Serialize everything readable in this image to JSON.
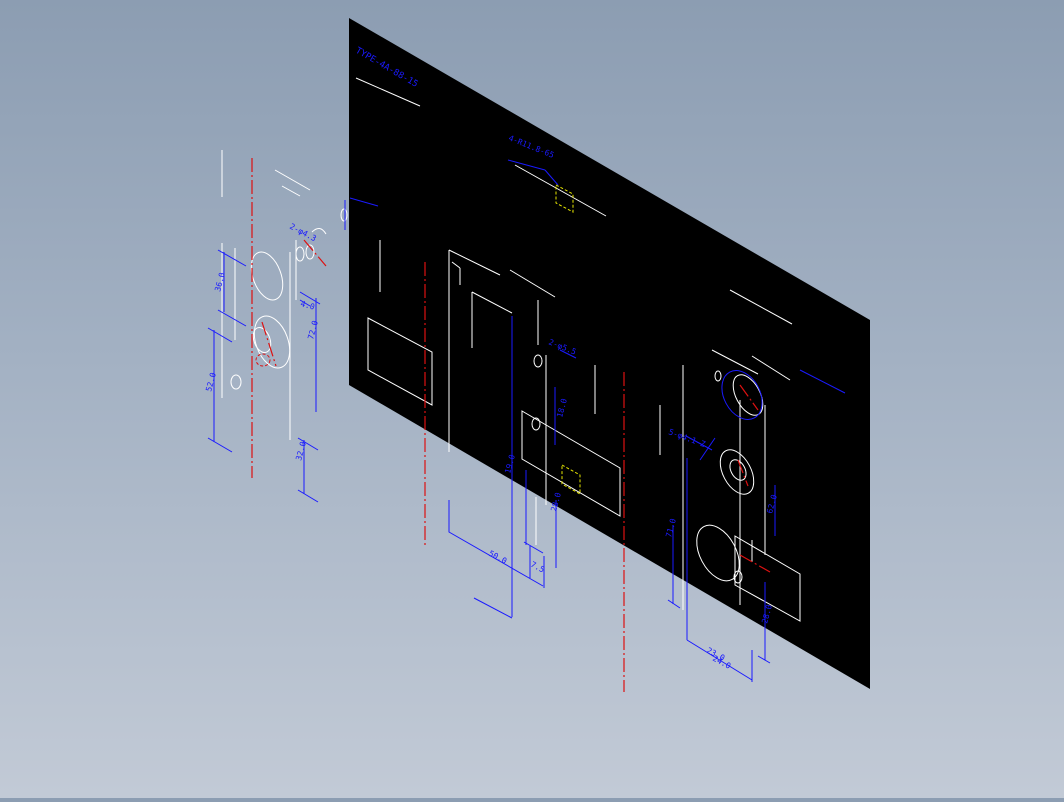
{
  "drawing": {
    "title_block_text": "TYPE-4A-88-15",
    "colors": {
      "sheet": "#000000",
      "outline": "#ffffff",
      "dimension": "#1a1aff",
      "centerline": "#dd1111",
      "hidden": "#e6e600"
    },
    "callouts": {
      "slot": "4-R11.8-65",
      "hole_pair_top": "2-φ4.3",
      "hole_pair_mid": "2-φ5.5",
      "hole_group_right": "5-φ4.1-Z"
    },
    "dimensions": {
      "left_36": "36.0",
      "left_40": "4.0",
      "left_72": "72.0",
      "left_52": "52.0",
      "left_32": "32.0",
      "mid_50": "50.0",
      "mid_19": "19.0",
      "mid_18": "18.0",
      "mid_7": "7.5",
      "mid_28": "28.0",
      "right_71": "71.0",
      "right_62": "62.0",
      "right_23": "23.0",
      "right_24": "24.0",
      "right_28": "28.0"
    }
  }
}
